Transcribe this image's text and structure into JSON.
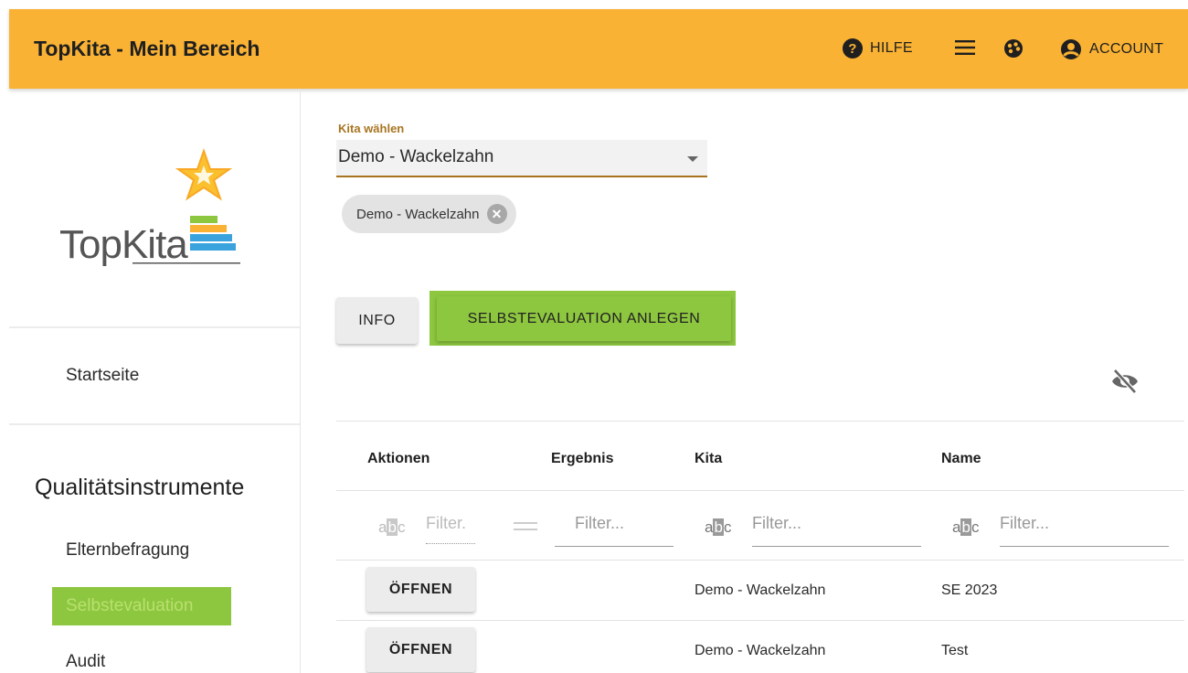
{
  "header": {
    "title": "TopKita - Mein Bereich",
    "help_label": "HILFE",
    "help_icon": "help-circle-icon",
    "menu_icon": "hamburger-menu-icon",
    "theme_icon": "palette-icon",
    "account_label": "ACCOUNT",
    "account_icon": "account-circle-icon",
    "bg_color": "#f9b233"
  },
  "sidebar": {
    "logo_text": "TopKita",
    "items": [
      {
        "label": "Startseite"
      },
      {
        "label": "Elternbefragung"
      },
      {
        "label": "Selbstevaluation",
        "active": true
      },
      {
        "label": "Audit"
      }
    ],
    "section_title": "Qualitätsinstrumente",
    "active_color": "#8dc63f"
  },
  "main": {
    "kita_select": {
      "label": "Kita wählen",
      "value": "Demo - Wackelzahn"
    },
    "chip_label": "Demo - Wackelzahn",
    "info_button": "INFO",
    "create_button": "SELBSTEVALUATION ANLEGEN",
    "table": {
      "columns": [
        "Aktionen",
        "Ergebnis",
        "Kita",
        "Name"
      ],
      "filters": {
        "aktionen_placeholder": "Filter.",
        "ergebnis_placeholder": "Filter...",
        "kita_placeholder": "Filter...",
        "name_placeholder": "Filter...",
        "type_icon_text": [
          "a",
          "b",
          "c"
        ]
      },
      "rows": [
        {
          "action": "ÖFFNEN",
          "ergebnis": "",
          "kita": "Demo - Wackelzahn",
          "name": "SE 2023"
        },
        {
          "action": "ÖFFNEN",
          "ergebnis": "",
          "kita": "Demo - Wackelzahn",
          "name": "Test"
        }
      ]
    }
  }
}
